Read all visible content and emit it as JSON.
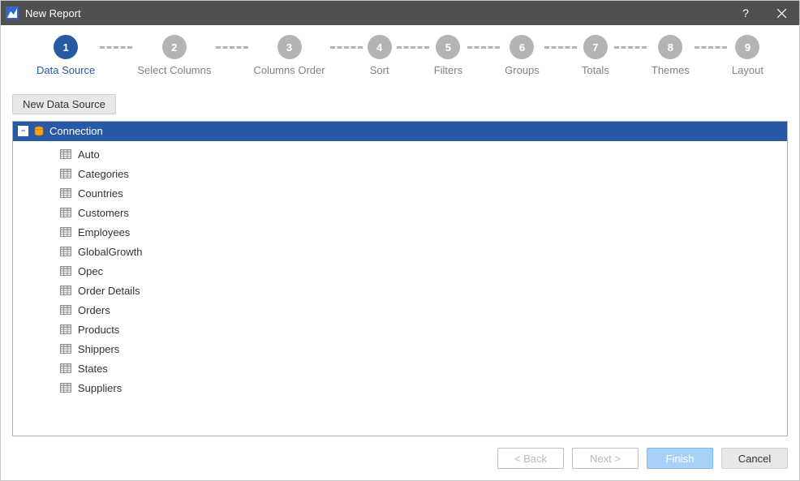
{
  "window": {
    "title": "New Report"
  },
  "stepper": {
    "active_index": 0,
    "steps": [
      {
        "num": "1",
        "label": "Data Source"
      },
      {
        "num": "2",
        "label": "Select Columns"
      },
      {
        "num": "3",
        "label": "Columns Order"
      },
      {
        "num": "4",
        "label": "Sort"
      },
      {
        "num": "5",
        "label": "Filters"
      },
      {
        "num": "6",
        "label": "Groups"
      },
      {
        "num": "7",
        "label": "Totals"
      },
      {
        "num": "8",
        "label": "Themes"
      },
      {
        "num": "9",
        "label": "Layout"
      }
    ]
  },
  "toolbar": {
    "new_data_source": "New Data Source"
  },
  "tree": {
    "root": {
      "label": "Connection",
      "expanded": true,
      "icon": "database-icon"
    },
    "items": [
      {
        "label": "Auto"
      },
      {
        "label": "Categories"
      },
      {
        "label": "Countries"
      },
      {
        "label": "Customers"
      },
      {
        "label": "Employees"
      },
      {
        "label": "GlobalGrowth"
      },
      {
        "label": "Opec"
      },
      {
        "label": "Order Details"
      },
      {
        "label": "Orders"
      },
      {
        "label": "Products"
      },
      {
        "label": "Shippers"
      },
      {
        "label": "States"
      },
      {
        "label": "Suppliers"
      }
    ]
  },
  "footer": {
    "back": "< Back",
    "next": "Next >",
    "finish": "Finish",
    "cancel": "Cancel"
  }
}
